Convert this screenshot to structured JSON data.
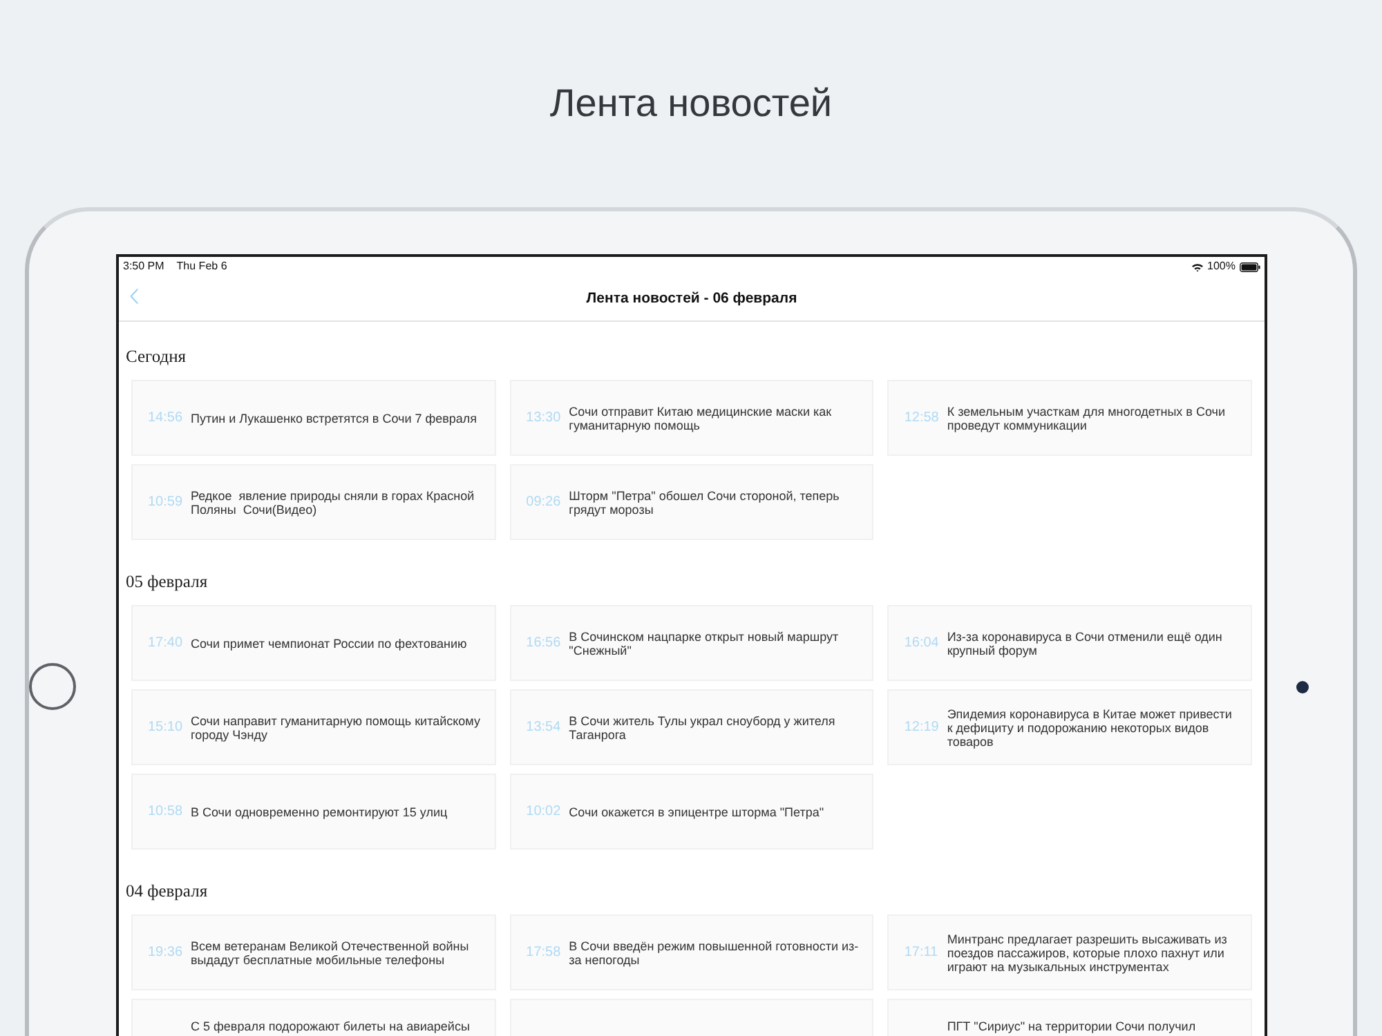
{
  "page": {
    "title": "Лента новостей"
  },
  "status_bar": {
    "time": "3:50 PM",
    "date": "Thu Feb 6",
    "battery": "100%"
  },
  "nav_bar": {
    "title": "Лента новостей - 06 февраля"
  },
  "sections": [
    {
      "heading": "Сегодня",
      "items": [
        {
          "kind": "full",
          "time": "14:56",
          "title": "Путин и Лукашенко встретятся в Сочи 7 февраля"
        },
        {
          "kind": "full",
          "time": "13:30",
          "title": "Сочи отправит Китаю медицинские маски как гуманитарную помощь"
        },
        {
          "kind": "full",
          "time": "12:58",
          "title": "К земельным участкам для многодетных в Сочи проведут коммуникации"
        },
        {
          "kind": "full",
          "time": "10:59",
          "title": "Редкое  явление природы сняли в горах Красной Поляны  Сочи(Видео)"
        },
        {
          "kind": "full",
          "time": "09:26",
          "title": "Шторм \"Петра\" обошел Сочи стороной, теперь грядут морозы"
        }
      ]
    },
    {
      "heading": "05 февраля",
      "items": [
        {
          "kind": "full",
          "time": "17:40",
          "title": "Сочи примет чемпионат России по фехтованию"
        },
        {
          "kind": "full",
          "time": "16:56",
          "title": "В Сочинском нацпарке открыт новый маршрут \"Снежный\""
        },
        {
          "kind": "full",
          "time": "16:04",
          "title": "Из-за коронавируса в Сочи отменили ещё один крупный форум"
        },
        {
          "kind": "full",
          "time": "15:10",
          "title": "Сочи направит гуманитарную помощь китайскому городу Чэнду"
        },
        {
          "kind": "full",
          "time": "13:54",
          "title": "В Сочи житель Тулы украл сноуборд у жителя Таганрога"
        },
        {
          "kind": "full",
          "time": "12:19",
          "title": "Эпидемия коронавируса в Китае может привести к дефициту и подорожанию некоторых видов товаров"
        },
        {
          "kind": "full",
          "time": "10:58",
          "title": "В Сочи одновременно ремонтируют 15 улиц"
        },
        {
          "kind": "full",
          "time": "10:02",
          "title": "Сочи окажется в эпицентре шторма \"Петра\""
        }
      ]
    },
    {
      "heading": "04 февраля",
      "items": [
        {
          "kind": "full",
          "time": "19:36",
          "title": "Всем ветеранам Великой Отечественной войны выдадут бесплатные мобильные телефоны"
        },
        {
          "kind": "full",
          "time": "17:58",
          "title": "В Сочи введён режим повышенной готовности из-за непогоды"
        },
        {
          "kind": "full",
          "time": "17:11",
          "title": "Минтранс предлагает разрешить высаживать из поездов пассажиров, которые плохо пахнут или играют на музыкальных инструментах"
        },
        {
          "kind": "cut",
          "title": "С 5 февраля подорожают билеты на авиарейсы"
        },
        {
          "kind": "cut"
        },
        {
          "kind": "cut",
          "title": "ПГТ \"Сириус\" на территории Сочи получил"
        }
      ]
    }
  ]
}
